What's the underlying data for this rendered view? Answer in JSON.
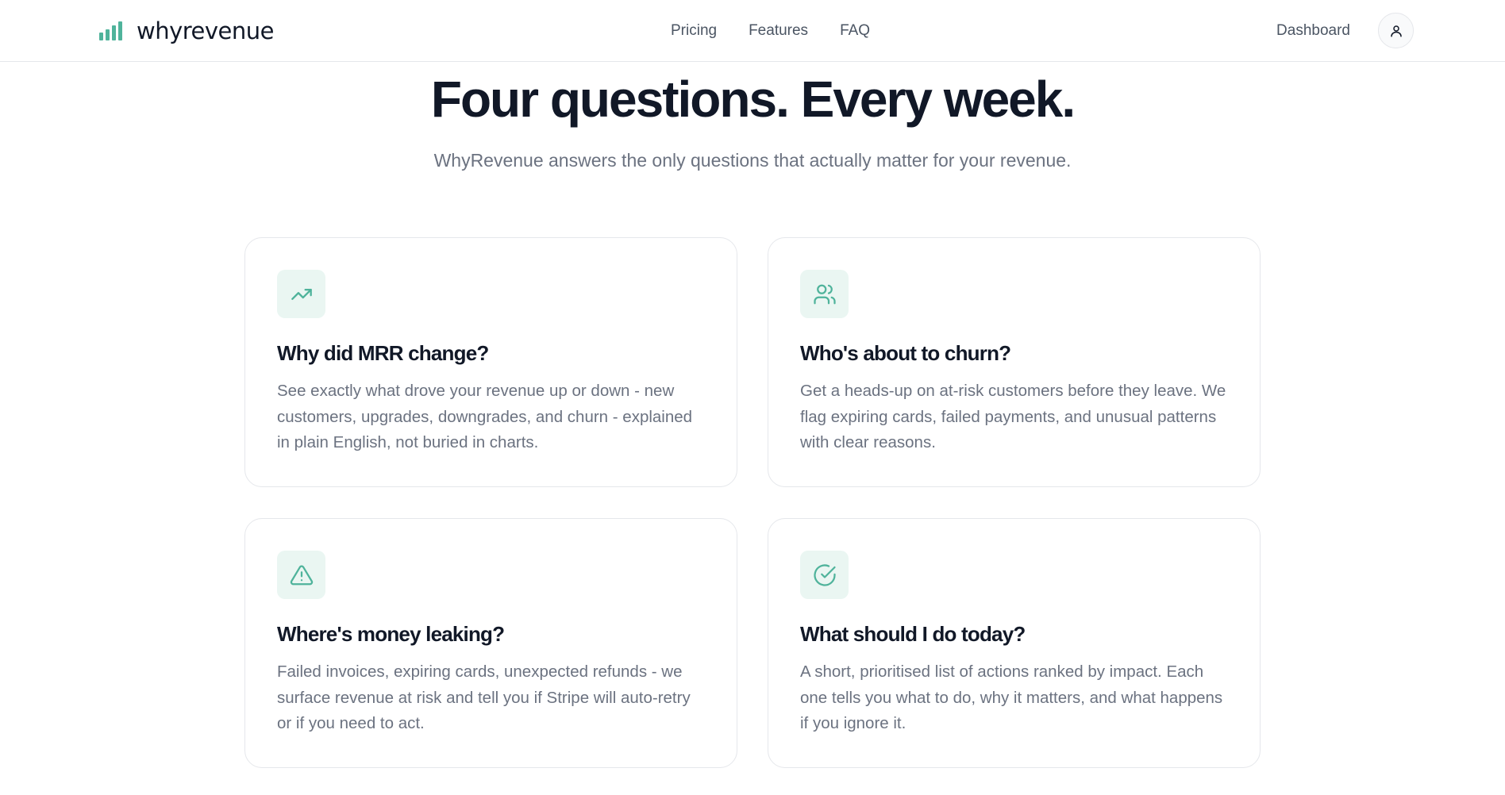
{
  "header": {
    "logo_text": "whyrevenue",
    "nav": [
      "Pricing",
      "Features",
      "FAQ"
    ],
    "dashboard_label": "Dashboard"
  },
  "hero": {
    "title": "Four questions. Every week.",
    "subtitle": "WhyRevenue answers the only questions that actually matter for your revenue."
  },
  "cards": [
    {
      "icon": "trending-up-icon",
      "title": "Why did MRR change?",
      "description": "See exactly what drove your revenue up or down - new customers, upgrades, downgrades, and churn - explained in plain English, not buried in charts."
    },
    {
      "icon": "users-icon",
      "title": "Who's about to churn?",
      "description": "Get a heads-up on at-risk customers before they leave. We flag expiring cards, failed payments, and unusual patterns with clear reasons."
    },
    {
      "icon": "alert-triangle-icon",
      "title": "Where's money leaking?",
      "description": "Failed invoices, expiring cards, unexpected refunds - we surface revenue at risk and tell you if Stripe will auto-retry or if you need to act."
    },
    {
      "icon": "check-circle-icon",
      "title": "What should I do today?",
      "description": "A short, prioritised list of actions ranked by impact. Each one tells you what to do, why it matters, and what happens if you ignore it."
    }
  ],
  "colors": {
    "accent": "#4fb39b",
    "icon_bg": "#eaf6f2",
    "text_primary": "#111827",
    "text_secondary": "#6b7280",
    "border": "#e5e7eb"
  }
}
